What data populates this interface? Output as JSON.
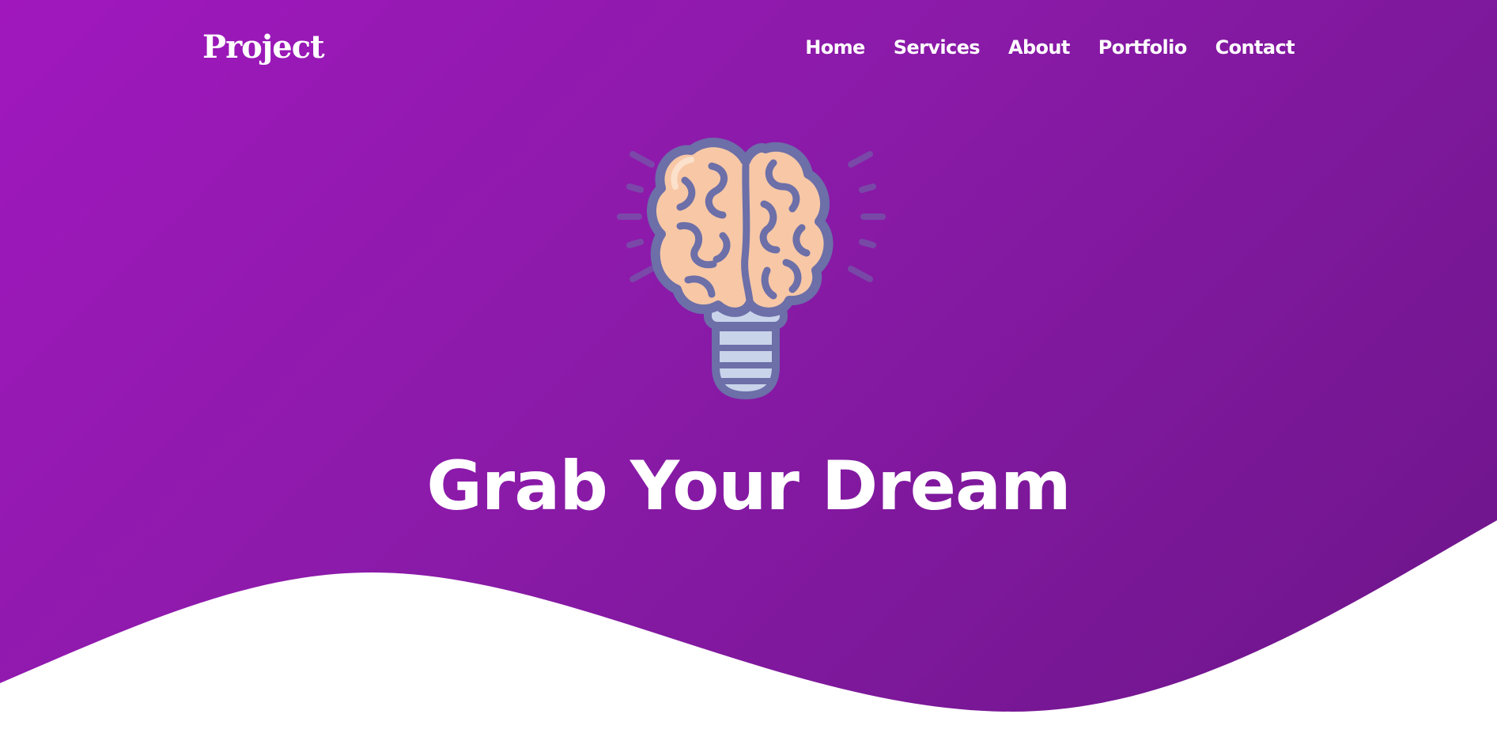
{
  "nav": {
    "logo": "Project",
    "items": [
      {
        "label": "Home"
      },
      {
        "label": "Services"
      },
      {
        "label": "About"
      },
      {
        "label": "Portfolio"
      },
      {
        "label": "Contact"
      }
    ]
  },
  "hero": {
    "illustration": "brain-lightbulb-icon",
    "headline": "Grab Your Dream"
  },
  "colors": {
    "gradient_start": "#a018bd",
    "gradient_end": "#6c1589",
    "text": "#ffffff",
    "illustration_outline": "#6c6fa8",
    "brain_fill": "#f7c7a6",
    "bulb_base_fill": "#c9d3ea"
  }
}
